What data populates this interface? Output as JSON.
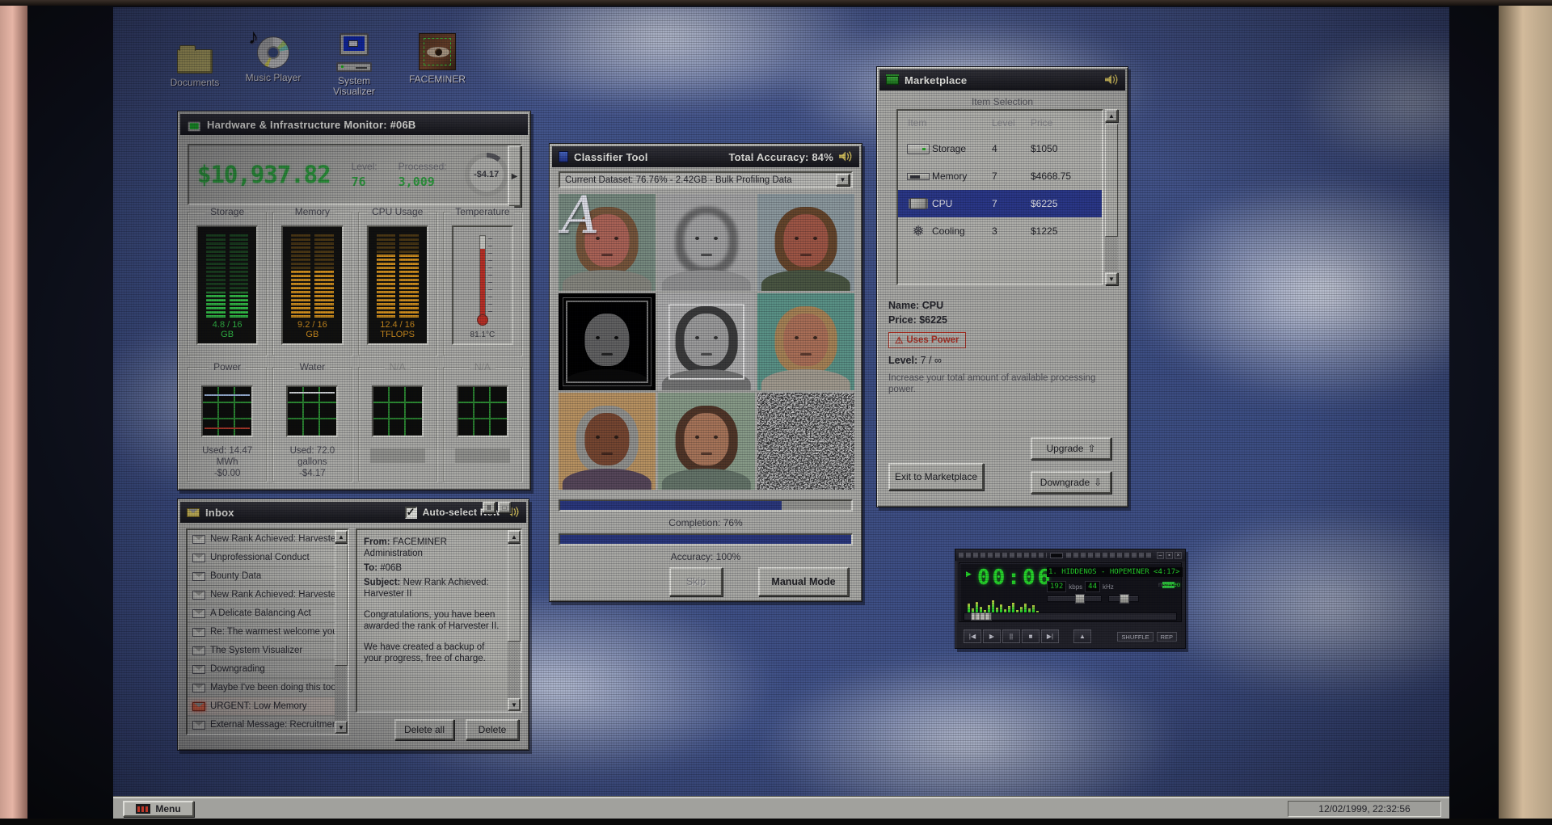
{
  "glyphs": {
    "up": "▲",
    "down": "▼",
    "right": "▶",
    "check": "✓",
    "warning": "⚠",
    "pause_small": "II",
    "doc_small": "□",
    "drop": "▼",
    "upgrade_arrow": "⇧",
    "downgrade_arrow": "⇩",
    "min": "–",
    "shade": "▪",
    "close": "×",
    "play_ind": "▶",
    "eject": "▲"
  },
  "desktop": {
    "icons": [
      {
        "label": "Documents"
      },
      {
        "label": "Music Player"
      },
      {
        "label": "System",
        "label2": "Visualizer"
      },
      {
        "label": "FACEMINER"
      }
    ]
  },
  "hardware": {
    "title": "Hardware & Infrastructure Monitor: #06B",
    "balance": "$10,937.82",
    "level_label": "Level:",
    "level_value": "76",
    "processed_label": "Processed:",
    "processed_value": "3,009",
    "rate": "-$4.17",
    "meters": [
      {
        "label": "Storage",
        "value": "4.8 / 16 GB",
        "fill": 30
      },
      {
        "label": "Memory",
        "value": "9.2 / 16 GB",
        "fill": 57
      },
      {
        "label": "CPU Usage",
        "value": "12.4 / 16 TFLOPS",
        "fill": 77
      },
      {
        "label": "Temperature",
        "value": "81.1°C",
        "fill": 72
      }
    ],
    "graphs": [
      {
        "label": "Power",
        "line1": "Used: 14.47 MWh",
        "line2": "-$0.00"
      },
      {
        "label": "Water",
        "line1": "Used: 72.0 gallons",
        "line2": "-$4.17"
      },
      {
        "label": "N/A"
      },
      {
        "label": "N/A"
      }
    ]
  },
  "inbox": {
    "title": "Inbox",
    "autoselect_label": "Auto-select New",
    "messages": [
      {
        "subject": "New Rank Achieved: Harveste..."
      },
      {
        "subject": "Unprofessional Conduct"
      },
      {
        "subject": "Bounty Data"
      },
      {
        "subject": "New Rank Achieved: Harvester I"
      },
      {
        "subject": "A Delicate Balancing Act"
      },
      {
        "subject": "Re: The warmest welcome you'r..."
      },
      {
        "subject": "The System Visualizer"
      },
      {
        "subject": "Downgrading"
      },
      {
        "subject": "Maybe I've been doing this too l..."
      },
      {
        "subject": "URGENT: Low Memory",
        "classes": "urgent"
      },
      {
        "subject": "External Message: Recruitment"
      }
    ],
    "email": {
      "from_label": "From:",
      "from_value": "FACEMINER Administration",
      "to_label": "To:",
      "to_value": "#06B",
      "subject_label": "Subject:",
      "subject_value": "New Rank Achieved: Harvester II",
      "body1": "Congratulations, you have been awarded the rank of Harvester II.",
      "body2": "We have created a backup of your progress, free of charge."
    },
    "delete_all_label": "Delete all",
    "delete_label": "Delete"
  },
  "classifier": {
    "title": "Classifier Tool",
    "accuracy_title": "Total Accuracy: 84%",
    "dataset": "Current Dataset: 76.76% - 2.42GB - Bulk Profiling Data",
    "completion_label": "Completion: 76%",
    "completion_pct": 76,
    "accuracy_label": "Accuracy: 100%",
    "accuracy_pct": 100,
    "skip_label": "Skip",
    "manual_label": "Manual Mode",
    "cells": [
      {
        "classes": "face",
        "letter": "A",
        "vars": {
          "--bg": "#7d9186",
          "--skin": "#b3685a",
          "--hair": "#7d5a3e",
          "--shirt": "#8d8d85"
        }
      },
      {
        "classes": "face gs blur",
        "vars": {
          "--bg": "#a7adb5",
          "--skin": "#a9a9a9",
          "--hair": "#6f6f6f",
          "--shirt": "#9a9a9a"
        }
      },
      {
        "classes": "face",
        "vars": {
          "--bg": "#93a1a6",
          "--skin": "#a65a49",
          "--hair": "#6b4a2e",
          "--shirt": "#4e5a46"
        }
      },
      {
        "classes": "face dark frame-green",
        "vars": {
          "--bg": "#0d0d0d",
          "--skin": "#8f8f8f",
          "--hair": "#1f1f1f",
          "--shirt": "#2c2c2c"
        }
      },
      {
        "classes": "face gs frame-white",
        "vars": {
          "--bg": "#b3b3b3",
          "--skin": "#a3a3a3",
          "--hair": "#3f3f3f",
          "--shirt": "#7a7a7a"
        }
      },
      {
        "classes": "face",
        "vars": {
          "--bg": "#5f9a8d",
          "--skin": "#b3755c",
          "--hair": "#b08a5a",
          "--shirt": "#a9a296"
        }
      },
      {
        "classes": "face",
        "vars": {
          "--bg": "#c29a66",
          "--skin": "#7c4a33",
          "--hair": "#9a9a96",
          "--shirt": "#5a4a5e"
        }
      },
      {
        "classes": "face",
        "vars": {
          "--bg": "#8fa38f",
          "--skin": "#b07a5e",
          "--hair": "#55392a",
          "--shirt": "#6a7a6e"
        }
      },
      {
        "classes": "noise"
      }
    ]
  },
  "marketplace": {
    "title": "Marketplace",
    "section_label": "Item Selection",
    "headers": [
      "Item",
      "Level",
      "Price"
    ],
    "rows": [
      {
        "item": "Storage",
        "level": "4",
        "price": "$1050",
        "classes": "i-storage"
      },
      {
        "item": "Memory",
        "level": "7",
        "price": "$4668.75",
        "classes": "i-memory"
      },
      {
        "item": "CPU",
        "level": "7",
        "price": "$6225",
        "classes": "i-cpu selected"
      },
      {
        "item": "Cooling",
        "level": "3",
        "price": "$1225",
        "classes": "i-cooling",
        "glyph": "❅"
      }
    ],
    "name_label": "Name:",
    "name_value": "CPU",
    "price_label": "Price:",
    "price_value": "$6225",
    "badge_label": "Uses Power",
    "level_label": "Level:",
    "level_value": "7 / ∞",
    "description": "Increase your total amount of available processing power.",
    "upgrade_label": "Upgrade",
    "exit_label": "Exit to Marketplace",
    "downgrade_label": "Downgrade"
  },
  "player": {
    "time": "00:06",
    "track": "1. HIDDENOS - HOPEMINER <4:17>",
    "bitrate": "192",
    "bitrate_unit": "kbps",
    "freq": "44",
    "freq_unit": "kHz",
    "mono_label": "mono",
    "stereo_label": "stereo",
    "shuffle_label": "SHUFFLE",
    "repeat_label": "REP",
    "eq": [
      14,
      8,
      16,
      10,
      6,
      12,
      18,
      9,
      13,
      7,
      11,
      15,
      6,
      10,
      14,
      8,
      12,
      5
    ],
    "controls": [
      "|◀",
      "▶",
      "||",
      "■",
      "▶|"
    ]
  },
  "taskbar": {
    "menu_label": "Menu",
    "clock": "12/02/1999, 22:32:56"
  }
}
